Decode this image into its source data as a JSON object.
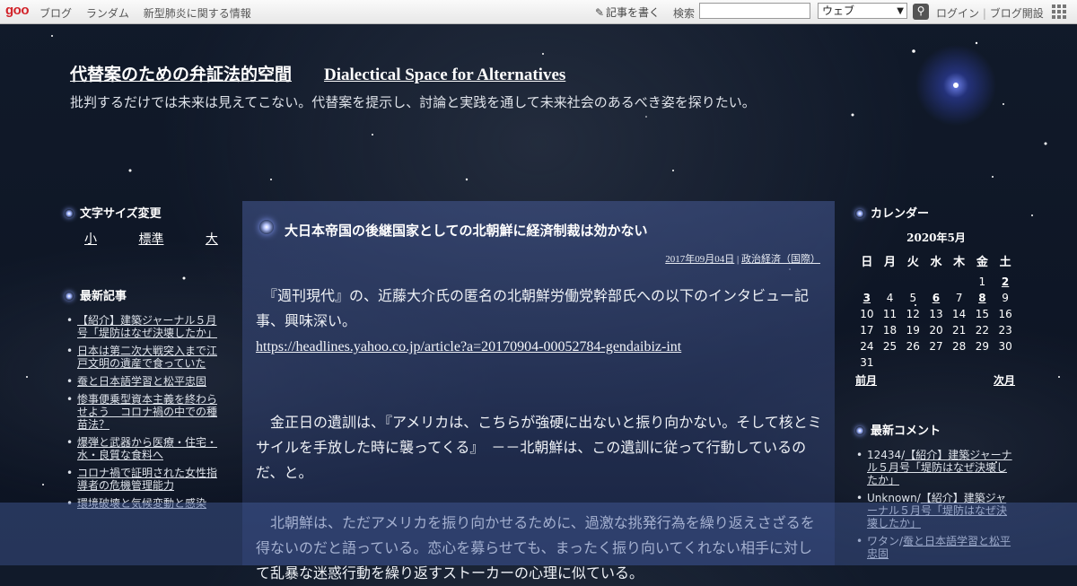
{
  "topbar": {
    "logo": "goo",
    "nav": [
      "ブログ",
      "ランダム",
      "新型肺炎に関する情報"
    ],
    "write_label": "記事を書く",
    "search_label": "検索",
    "search_value": "",
    "search_scope": "ウェブ",
    "login": "ログイン",
    "separator": "|",
    "open_blog": "ブログ開設"
  },
  "header": {
    "title_ja": "代替案のための弁証法的空間",
    "title_en": "Dialectical Space for Alternatives",
    "description": "批判するだけでは未来は見えてこない。代替案を提示し、討論と実践を通して未来社会のあるべき姿を探りたい。"
  },
  "left_sidebar": {
    "font_size_heading": "文字サイズ変更",
    "font_sizes": [
      "小",
      "標準",
      "大"
    ],
    "recent_heading": "最新記事",
    "recent_items": [
      "【紹介】建築ジャーナル５月号「堤防はなぜ決壊したか」",
      "日本は第二次大戦突入まで江戸文明の遺産で食っていた",
      "蚕と日本語学習と松平忠固",
      "惨事便乗型資本主義を終わらせよう　コロナ禍の中での種苗法？",
      "爆弾と武器から医療・住宅・水・良質な食料へ",
      "コロナ禍で証明された女性指導者の危機管理能力",
      "環境破壊と気候変動と感染"
    ]
  },
  "post": {
    "title": "大日本帝国の後継国家としての北朝鮮に経済制裁は効かない",
    "date": "2017年09月04日",
    "meta_sep": " | ",
    "category": "政治経済（国際）",
    "para1": "　『週刊現代』の、近藤大介氏の匿名の北朝鮮労働党幹部氏への以下のインタビュー記事、興味深い。",
    "link": "https://headlines.yahoo.co.jp/article?a=20170904-00052784-gendaibiz-int",
    "para2": "　金正日の遺訓は、『アメリカは、こちらが強硬に出ないと振り向かない。そして核とミサイルを手放した時に襲ってくる』　－－北朝鮮は、この遺訓に従って行動しているのだ、と。",
    "para3": "　北朝鮮は、ただアメリカを振り向かせるために、過激な挑発行為を繰り返えさざるを得ないのだと語っている。恋心を募らせても、まったく振り向いてくれない相手に対して乱暴な迷惑行動を繰り返すストーカーの心理に似ている。"
  },
  "calendar": {
    "heading": "カレンダー",
    "month": "2020年5月",
    "weekdays": [
      "日",
      "月",
      "火",
      "水",
      "木",
      "金",
      "土"
    ],
    "weeks": [
      [
        "",
        "",
        "",
        "",
        "",
        "1",
        "2"
      ],
      [
        "3",
        "4",
        "5",
        "6",
        "7",
        "8",
        "9"
      ],
      [
        "10",
        "11",
        "12",
        "13",
        "14",
        "15",
        "16"
      ],
      [
        "17",
        "18",
        "19",
        "20",
        "21",
        "22",
        "23"
      ],
      [
        "24",
        "25",
        "26",
        "27",
        "28",
        "29",
        "30"
      ],
      [
        "31",
        "",
        "",
        "",
        "",
        "",
        ""
      ]
    ],
    "linked_days": [
      "2",
      "3",
      "6",
      "8"
    ],
    "prev": "前月",
    "next": "次月"
  },
  "comments": {
    "heading": "最新コメント",
    "items": [
      {
        "author": "12434/",
        "title": "【紹介】建築ジャーナル５月号「堤防はなぜ決壊したか」"
      },
      {
        "author": "Unknown/",
        "title": "【紹介】建築ジャーナル５月号「堤防はなぜ決壊したか」"
      },
      {
        "author": "ワタン/",
        "title": "蚕と日本語学習と松平忠固"
      }
    ]
  }
}
